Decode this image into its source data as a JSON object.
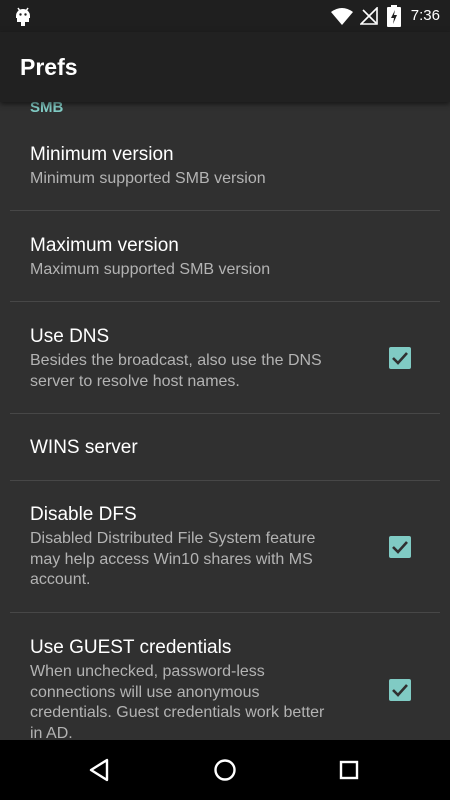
{
  "status_bar": {
    "time": "7:36",
    "icons": [
      "android-notification-icon",
      "wifi-icon",
      "no-signal-icon",
      "battery-charging-icon"
    ]
  },
  "app_bar": {
    "title": "Prefs"
  },
  "category": {
    "label": "SMB"
  },
  "prefs": {
    "min_version": {
      "title": "Minimum version",
      "summary": "Minimum supported SMB version"
    },
    "max_version": {
      "title": "Maximum version",
      "summary": "Maximum supported SMB version"
    },
    "use_dns": {
      "title": "Use DNS",
      "summary_line1": "Besides the broadcast, also use the DNS",
      "summary_line2": "server to resolve host names.",
      "checked": true
    },
    "wins_server": {
      "title": "WINS server"
    },
    "disable_dfs": {
      "title": "Disable DFS",
      "summary_line1": "Disabled Distributed File System feature",
      "summary_line2": "may help access Win10 shares with MS",
      "summary_line3": "account.",
      "checked": true
    },
    "use_guest": {
      "title": "Use GUEST credentials",
      "summary_line1": "When unchecked, password-less",
      "summary_line2": "connections will use anonymous",
      "summary_line3": "credentials. Guest credentials work better",
      "summary_line4": "in AD.",
      "checked": true
    }
  },
  "nav_bar": {
    "buttons": [
      "back-icon",
      "home-icon",
      "recents-icon"
    ]
  },
  "colors": {
    "accent": "#80cbc4",
    "background": "#303030",
    "app_bar": "#212121",
    "status_bar": "#1f1f1f",
    "nav_bar": "#000000"
  }
}
